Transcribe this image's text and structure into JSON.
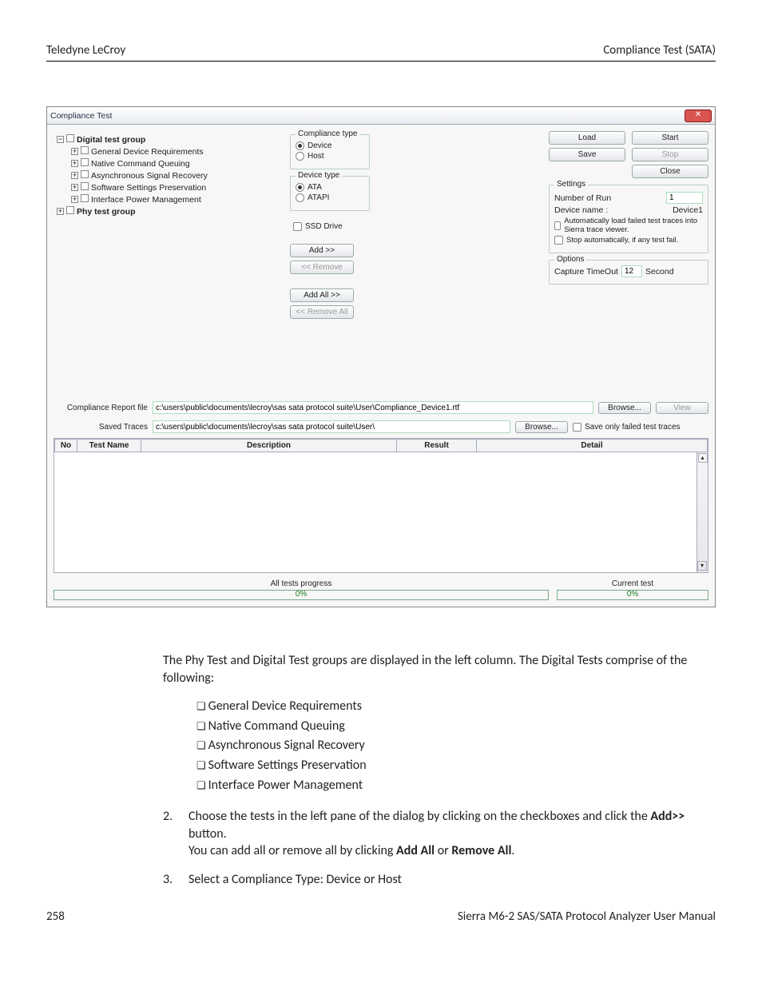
{
  "header": {
    "left": "Teledyne LeCroy",
    "right": "Compliance Test (SATA)"
  },
  "win": {
    "title": "Compliance Test",
    "close_glyph": "✕"
  },
  "tree": {
    "root1": "Digital test group",
    "items": [
      "General Device Requirements",
      "Native Command Queuing",
      "Asynchronous Signal Recovery",
      "Software Settings Preservation",
      "Interface Power Management"
    ],
    "root2": "Phy test group"
  },
  "mid": {
    "comp_legend": "Compliance type",
    "device": "Device",
    "host": "Host",
    "dev_legend": "Device type",
    "ata": "ATA",
    "atapi": "ATAPI",
    "ssd": "SSD Drive",
    "add": "Add >>",
    "remove": "<< Remove",
    "addall": "Add All >>",
    "removeall": "<< Remove All"
  },
  "right": {
    "load": "Load",
    "start": "Start",
    "save": "Save",
    "stop": "Stop",
    "close": "Close",
    "settings": "Settings",
    "numrun_lbl": "Number of Run",
    "numrun_val": "1",
    "devname_lbl": "Device name :",
    "devname_val": "Device1",
    "autoload": "Automatically load failed test traces into Sierra trace viewer.",
    "stopauto": "Stop automatically, if any test fail.",
    "options": "Options",
    "capto_lbl": "Capture TimeOut",
    "capto_val": "12",
    "capto_unit": "Second"
  },
  "paths": {
    "report_lbl": "Compliance Report file",
    "report_val": "c:\\users\\public\\documents\\lecroy\\sas sata protocol suite\\User\\Compliance_Device1.rtf",
    "browse": "Browse...",
    "view": "View",
    "traces_lbl": "Saved Traces",
    "traces_val": "c:\\users\\public\\documents\\lecroy\\sas sata protocol suite\\User\\",
    "save_only": "Save only failed test traces"
  },
  "table": {
    "no": "No",
    "name": "Test Name",
    "desc": "Description",
    "result": "Result",
    "detail": "Detail"
  },
  "progress": {
    "all_lbl": "All tests progress",
    "all_pct": "0%",
    "cur_lbl": "Current test",
    "cur_pct": "0%"
  },
  "doc": {
    "intro": "The Phy Test and Digital Test groups are displayed in the left column. The Digital Tests comprise of the following:",
    "bullets": [
      "General Device Requirements",
      "Native Command Queuing",
      "Asynchronous Signal Recovery",
      "Software Settings Preservation",
      "Interface Power Management"
    ],
    "step2_a": "Choose the tests in the left pane of the dialog by clicking on the checkboxes and click the ",
    "step2_b": "Add>>",
    "step2_c": " button.",
    "step2_line2_a": "You can add all or remove all by clicking ",
    "step2_line2_b": "Add All",
    "step2_line2_c": " or ",
    "step2_line2_d": "Remove All",
    "step2_line2_e": ".",
    "step3": "Select a Compliance Type: Device or Host"
  },
  "footer": {
    "left": "258",
    "right": "Sierra M6-2 SAS/SATA Protocol Analyzer User Manual"
  }
}
